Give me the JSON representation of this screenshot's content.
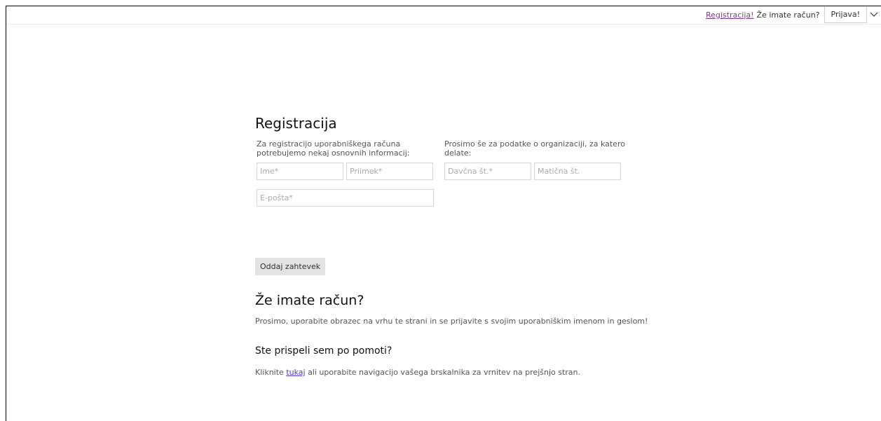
{
  "header": {
    "register_link": "Registracija!",
    "have_account": "Že imate račun?",
    "login_button": "Prijava!"
  },
  "form": {
    "title": "Registracija",
    "intro_left": "Za registracijo uporabniškega računa potrebujemo nekaj osnovnih informacij:",
    "intro_right": "Prosimo še za podatke o organizaciji, za katero delate:",
    "first_name_placeholder": "Ime*",
    "last_name_placeholder": "Priimek*",
    "email_placeholder": "E-pošta*",
    "tax_number_placeholder": "Davčna št.*",
    "registration_number_placeholder": "Matična št.",
    "submit_label": "Oddaj zahtevek"
  },
  "account_section": {
    "heading": "Že imate račun?",
    "text": "Prosimo, uporabite obrazec na vrhu te strani in se prijavite s svojim uporabniškim imenom in geslom!"
  },
  "help_section": {
    "heading": "Ste prispeli sem po pomoti?",
    "text_before": "Kliknite ",
    "link_text": "tukaj",
    "text_after": " ali uporabite navigacijo vašega brskalnika za vrnitev na prejšnjo stran."
  }
}
